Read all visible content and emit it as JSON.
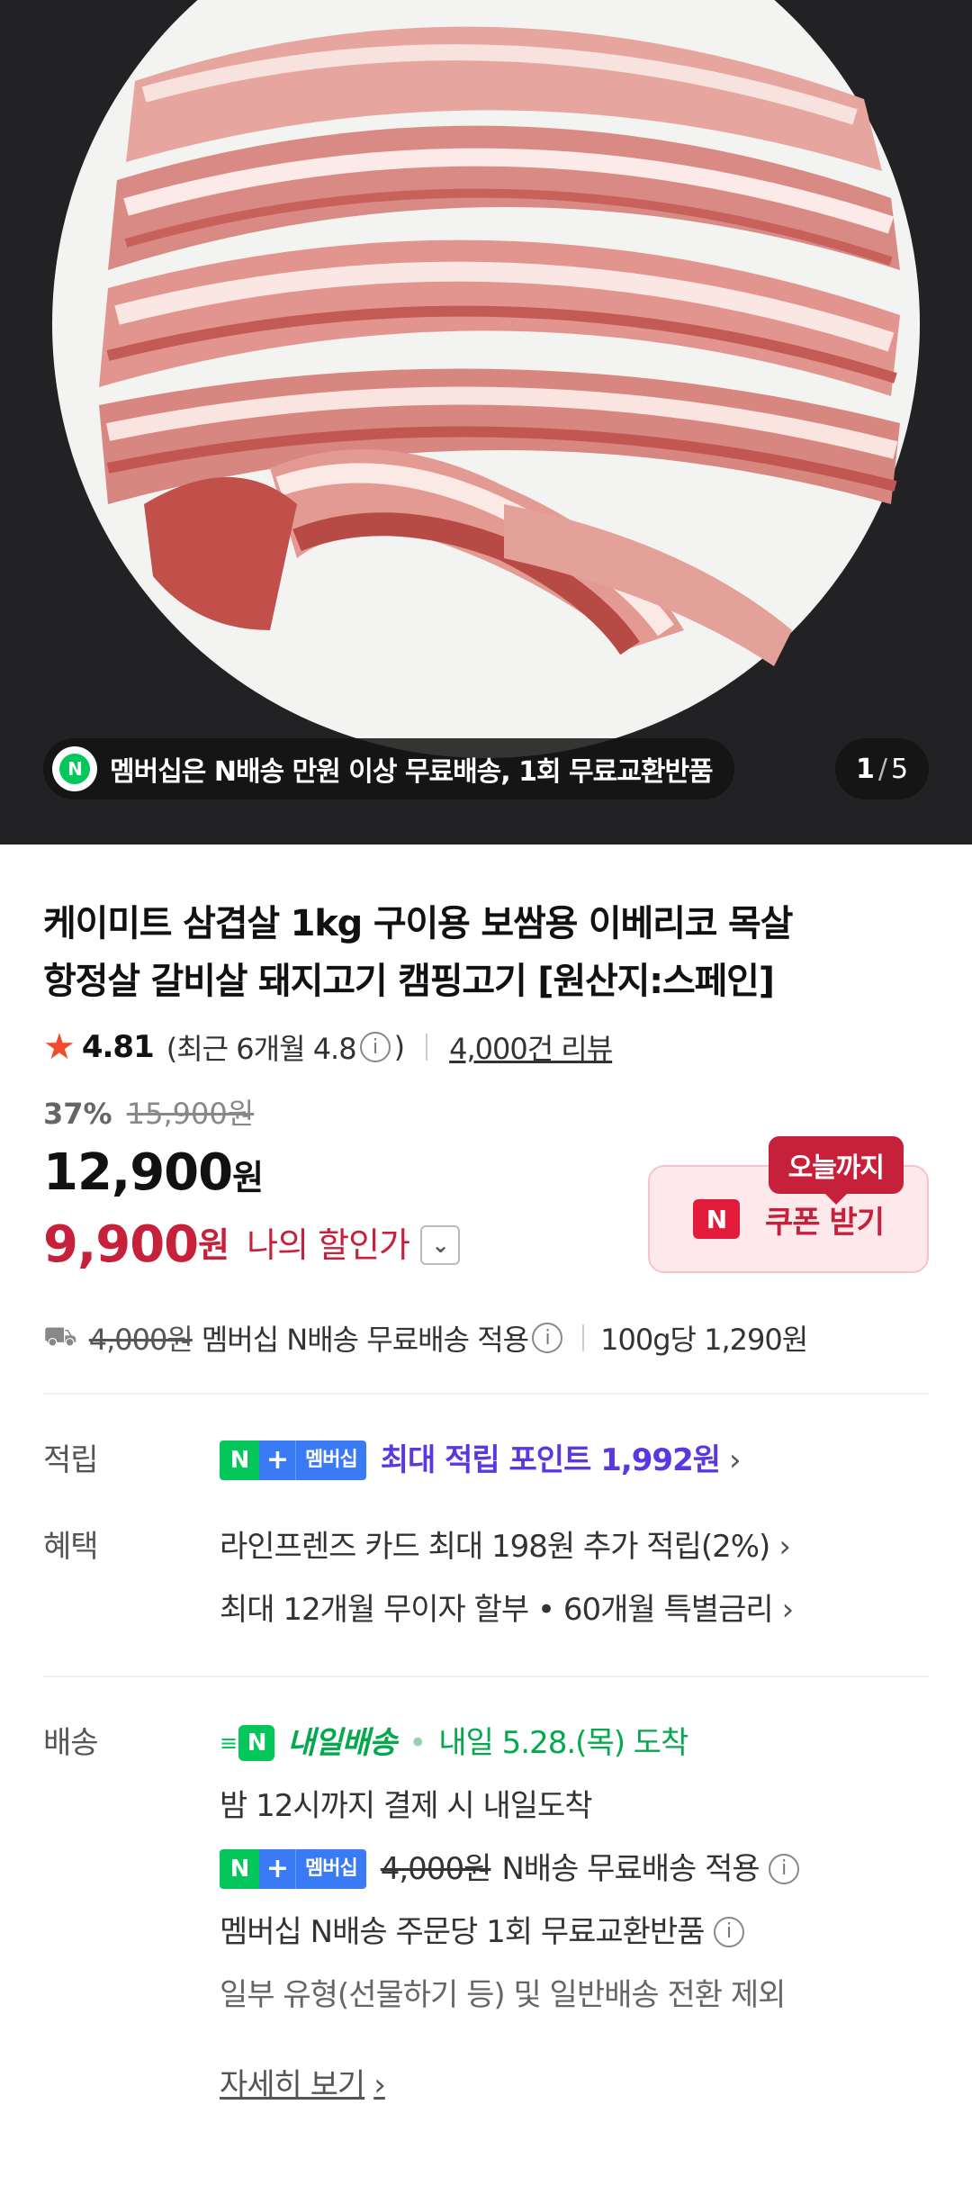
{
  "hero": {
    "banner_text": "멤버십은 N배송 만원 이상 무료배송, 1회 무료교환반품",
    "banner_icon_letter": "N",
    "counter_current": "1",
    "counter_total": "5"
  },
  "product": {
    "title_line1": "케이미트 삼겹살 1kg 구이용 보쌈용 이베리코 목살",
    "title_line2": "항정살 갈비살 돼지고기 캠핑고기 [원산지:스페인]",
    "rating": "4.81",
    "rating_recent": "(최근 6개월 4.8",
    "rating_recent_close": ")",
    "review_count": "4,000건 리뷰"
  },
  "price": {
    "discount_rate": "37%",
    "original_price": "15,900원",
    "sale_price": "12,900",
    "sale_unit": "원",
    "my_price": "9,900",
    "my_unit": "원",
    "my_label": "나의 할인가",
    "coupon_badge": "오늘까지",
    "coupon_label": "쿠폰 받기",
    "coupon_icon_letter": "N"
  },
  "shipping_summary": {
    "old_fee": "4,000원",
    "text": "멤버십 N배송 무료배송 적용",
    "unit_price": "100g당 1,290원"
  },
  "points": {
    "label": "적립",
    "membership_tag": "멤버십",
    "text": "최대 적립 포인트 1,992원"
  },
  "benefits": {
    "label": "혜택",
    "line1": "라인프렌즈 카드 최대 198원 추가 적립(2%)",
    "line2": "최대 12개월 무이자 할부 • 60개월 특별금리"
  },
  "delivery": {
    "label": "배송",
    "type_name": "내일배송",
    "arrival": "내일 5.28.(목) 도착",
    "cutoff": "밤 12시까지 결제 시 내일도착",
    "membership_tag": "멤버십",
    "old_fee": "4,000원",
    "free_text": "N배송 무료배송 적용",
    "exchange_text": "멤버십 N배송 주문당 1회 무료교환반품",
    "exclusion_text": "일부 유형(선물하기 등) 및 일반배송 전환 제외",
    "more_link": "자세히 보기"
  },
  "colors": {
    "accent_red": "#c7203b",
    "naver_green": "#03c75a",
    "point_purple": "#5a37e0",
    "membership_blue": "#3a7bf5"
  }
}
